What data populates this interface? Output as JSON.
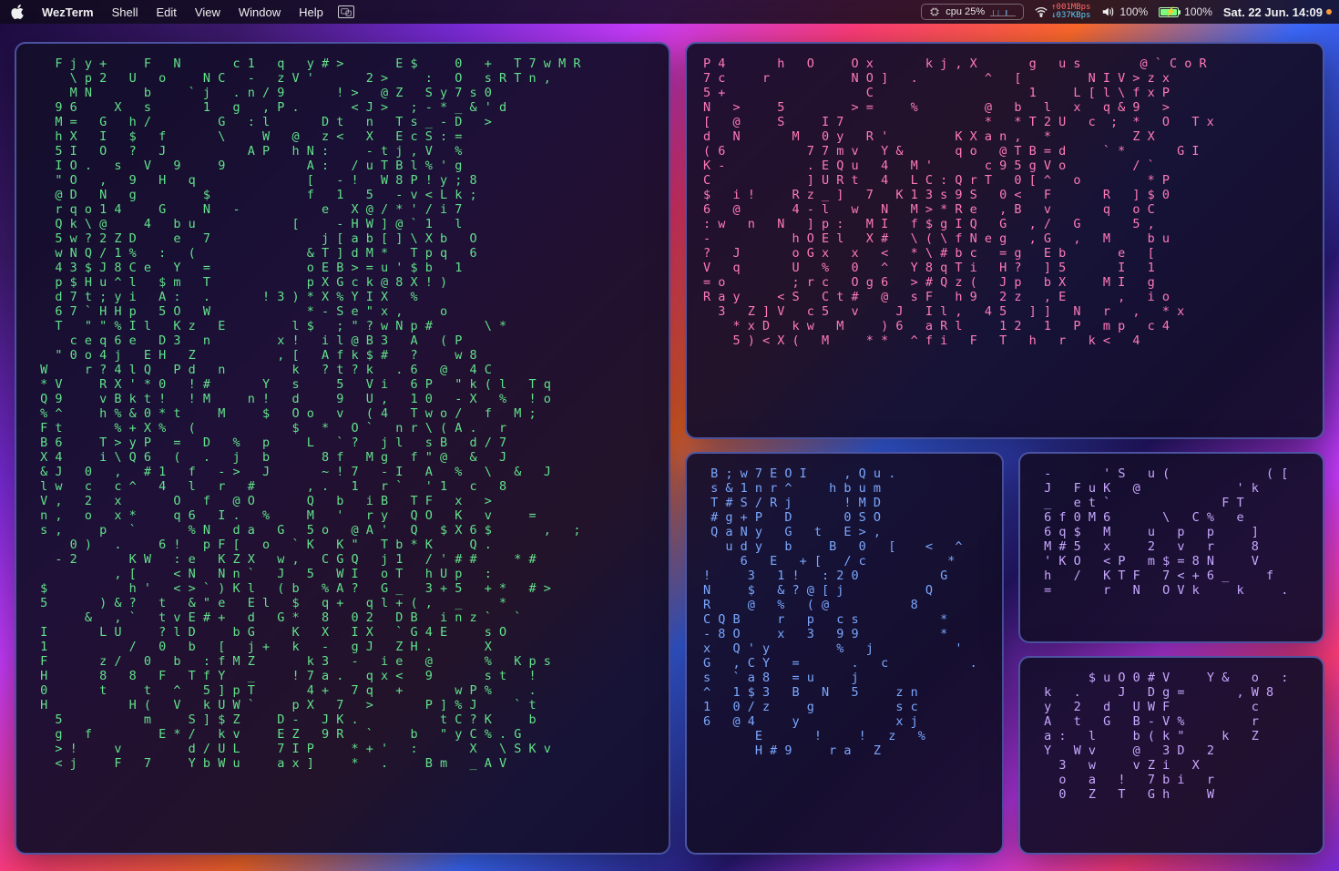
{
  "menubar": {
    "app": "WezTerm",
    "items": [
      "Shell",
      "Edit",
      "View",
      "Window",
      "Help"
    ],
    "cpu_label": "cpu",
    "cpu_pct": "25%",
    "net_up": "↑001MBps",
    "net_dn": "↓037KBps",
    "vol_pct": "100%",
    "batt_pct": "100%",
    "clock": "Sat. 22 Jun. 14:09"
  },
  "panes": {
    "green": "   F j y +     F   N       c 1   q   y # >       E $     0   +   T 7 w M R\n     \\ p 2   U   o     N C   -   z V '       2 >     :   O   s R T n ,\n     M N       b     ` j   . n / 9       ! >   @ Z   S y 7 s 0\n   9 6     X   s       1   g   , P .       < J >   ; - * _ & ' d\n   M =   G   h /         G   : l       D t   n   T s _ - D   >\n   h X   I   $   f       \\     W   @   z <   X   E c S : =\n   5 I   O   ?   J           A P   h N :     - t j , V   %\n   I O .   s   V   9     9           A :   / u T B l % ' g\n   \" O   ,   9   H   q               [   - !   W 8 P ! y ; 8\n   @ D   N   g         $             f   1   5   - v < L k ;\n   r q o 1 4     G     N   -           e   X @ / * ' / i 7\n   Q k \\ @     4   b u             [     - H W ] @ ` 1   l\n   5 w ? 2 Z D     e   7               j [ a b [ ] \\ X b   O\n   w N Q / 1 %   :   (               & T ] d M *   T p q   6\n   4 3 $ J 8 C e   Y   =             o E B > = u ' $ b   1\n   p $ H u ^ l   $ m   T             p X G c k @ 8 X ! )\n   d 7 t ; y i   A :   .       ! 3 ) * X % Y I X   %\n   6 7 ` H H p   5 O   W             * - S e \" x ,     o\n   T   \" \" % I l   K z   E         l $   ; \" ? w N p #       \\ *\n     c e q 6 e   D 3   n         x !   i l @ B 3   A   ( P\n   \" 0 o 4 j   E H   Z           , [   A f k $ #   ?     w 8\n W     r ? 4 l Q   P d   n         k   ? t ? k   . 6   @   4 C\n * V     R X ' * 0   ! #       Y   s     5   V i   6 P   \" k ( l   T q\n Q 9     v B k t !   ! M     n !   d     9   U ,   1 0   - X   %   ! o\n % ^     h % & 0 * t     M     $   O o   v   ( 4   T w o /   f   M ;\n F t       % + X %   (             $   *   O `   n r \\ ( A .   r\n B 6     T > y P   =   D   %   p     L   ` ?   j l   s B   d / 7\n X 4     i \\ Q 6   (   .   j   b       8 f   M g   f \" @   &   J\n & J   0   ,   # 1   f   - >   J       ~ ! 7   - I   A   %   \\   &   J\n l w   c   c ^   4   l   r   #       , .   1   r `   ' 1   c   8\n V ,   2   x       O   f   @ O       Q   b   i B   T F   x   >\n n ,   o   x *     q 6   I .   %     M   '   r y   Q O   K   v     =\n s ,     p   `       % N   d a   G   5 o   @ A '   Q   $ X 6 $       ,   ;\n     0 )   .     6 !   p F [   o   ` K   K \"   T b * K     Q .\n   - 2       K W   : e   K Z X   w ,   C G Q   j 1   / ' # #     * #\n           , [     < N   N n `   J   5   W I   o T   h U p   :\n $           h '   < > ` ) K l   ( b   % A ?   G _   3 + 5   + *   # >\n 5       ) & ?   t   & \" e   E l   $   q +   q l + ( ,   _     *\n       &   , `   t v E # +   d   G *   8   0 2   D B   i n z `   `\n I       L U     ? l D     b G     K   X   I X   ` G 4 E     s O\n 1           /   0   b   [   j +   k   -   g J   Z H .       X\n F       z /   0   b   : f M Z       k 3   -   i e   @       %   K p s\n H       8   8   F   T f Y   _     ! 7 a .   q x <   9       s t   !\n 0       t     t   ^   5 ] p T       4 +   7 q   +       w P %     .\n H           H (   V   k U W `     p X   7   >       P ] % J     ` t\n   5           m     S ] $ Z     D -   J K .           t C ? K     b\n   g   f         E * /   k v     E Z   9 R   `     b   \" y C % . G\n   > !     v         d / U L     7 I P     * + '   :       X   \\ S K v\n   < j     F   7     Y b W u     a x ]     *   .     B m   _ A V",
    "pink": "P 4       h   O     O x       k j , X       g   u s        @ ` C o R\n7 c     r           N O ]   .         ^   [         N I V > z x\n5 +                   C                     1     L [ l \\ f x P\nN   >     5         > =     %         @   b   l   x   q & 9   >\n[   @     S     I 7                   *   * T 2 U   c  ;  *   O   T x\nd   N       M   0 y   R '         K X a n ,   *           Z X\n( 6           7 7 m v   Y &       q o   @ T B = d     ` *       G I\nK -           . E Q u   4   M '       c 9 5 g V o         / `\nC             ] U R t   4   L C : Q r T   0 [ ^   o         * P\n$   i !     R z _ ]   7   K 1 3 s 9 S   0 <   F       R   ] $ 0\n6   @       4 - l   w   N   M > * R e   , B   v       q   o C\n: w   n   N   ] p :   M I   f $ g I Q   G   , /   G       5 ,\n-           h O E l   X #   \\ ( \\ f N e g   , G   ,   M     b u\n?   J       o G x   x   <   * \\ # b c   = g   E b       e   [\nV   q       U   %   0   ^   Y 8 q T i   H ?   ] 5       I   1\n= o         ; r c   O g 6   > # Q z (   J p   b X     M I   g\nR a y     < S   C t #   @   s F   h 9   2 z   , E       ,   i o\n  3   Z ] V   c 5   v     J   I l ,   4 5   ] ]   N   r   ,   * x\n    * x D   k w   M     ) 6   a R l     1 2   1   P   m p   c 4\n    5 ) < X (   M     * *   ^ f i   F   T   h   r   k <   4",
    "blue": " B ; w 7 E O I     , Q u .\n s & 1 n r ^     h b u m\n T # S / R j       ! M D\n # g + P   D       0 S O\n Q a N y   G   t   E > ,\n   u d y   b     B   0   [    <   ^\n     6   E   + [   / c           *\n!     3   1 !   : 2 0           G\nN     $   & ? @ [ j           Q\nR     @   %   ( @           8\nC Q B     r   p   c s           *\n- 8 O     x   3   9 9           *\nx   Q ' y         %   j           '\nG   , C Y   =       .   c           .\ns   ` a 8   = u     j\n^   1 $ 3   B   N   5     z n\n1   0 / z     g           s c\n6   @ 4     y             x j\n       E       !     !   z   %\n       H # 9     r a   Z",
    "lilac1": " -       ' S   u (             ( [\n J   F u K   @             ' k\n _   e t `               F T\n 6 f 0 M 6       \\   C %   e\n 6 q $   M     u   p   p     ]\n M # 5   x     2   v   r     8\n ' K O   < P   m $ = 8 N     V\n h   /   K T F   7 < + 6 _     f\n =       r   N   O V k     k     .",
    "lilac2": "       $ u O 0 # V     Y &   o   :\n k   .     J   D g =       , W 8\n y   2   d   U W F           c\n A   t   G   B - V %         r\n a :   l     b ( k \"     k   Z\n Y   W v     @   3 D   2\n   3   w     v Z i   X\n   o   a   !   7 b i   r\n   0   Z   T   G h     W"
  }
}
